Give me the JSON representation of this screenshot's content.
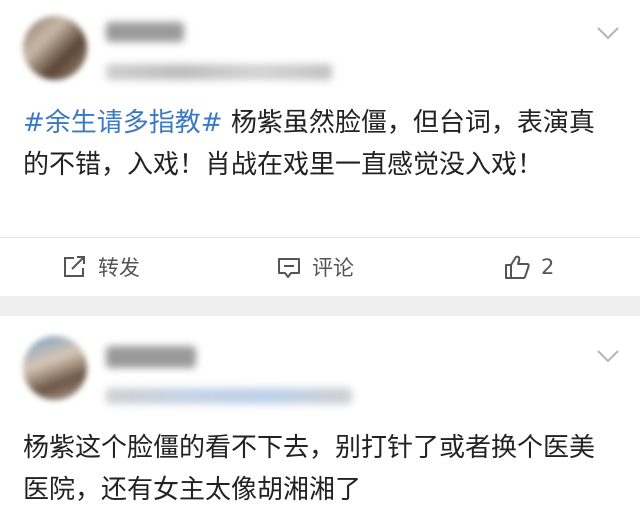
{
  "posts": [
    {
      "hashtag": "#余生请多指教#",
      "text": " 杨紫虽然脸僵，但台词，表演真的不错，入戏！肖战在戏里一直感觉没入戏！",
      "actions": {
        "repost_label": "转发",
        "comment_label": "评论",
        "like_count": "2"
      }
    },
    {
      "text": "杨紫这个脸僵的看不下去，别打针了或者换个医美医院，还有女主太像胡湘湘了"
    }
  ],
  "icons": {
    "menu": "chevron-down-icon",
    "repost": "share-icon",
    "comment": "comment-icon",
    "like": "thumbs-up-icon"
  },
  "colors": {
    "hashtag": "#3b79c0",
    "text": "#222222",
    "separator": "#efefef"
  }
}
